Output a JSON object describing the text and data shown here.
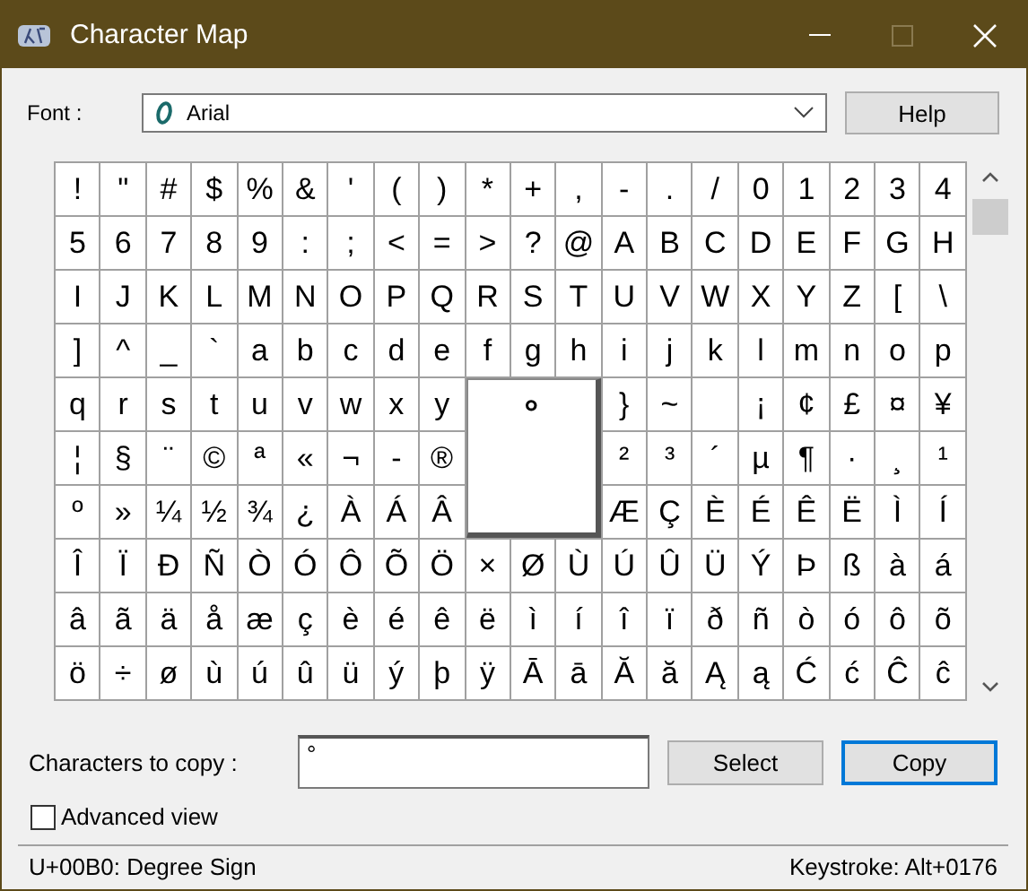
{
  "window": {
    "title": "Character Map",
    "maximize_disabled": true
  },
  "font": {
    "label": "Font :",
    "value": "Arial"
  },
  "help_button": "Help",
  "grid": [
    [
      "!",
      "\"",
      "#",
      "$",
      "%",
      "&",
      "'",
      "(",
      ")",
      "*",
      "+",
      ",",
      "-",
      ".",
      "/",
      "0",
      "1",
      "2",
      "3",
      "4"
    ],
    [
      "5",
      "6",
      "7",
      "8",
      "9",
      ":",
      ";",
      "<",
      "=",
      ">",
      "?",
      "@",
      "A",
      "B",
      "C",
      "D",
      "E",
      "F",
      "G",
      "H"
    ],
    [
      "I",
      "J",
      "K",
      "L",
      "M",
      "N",
      "O",
      "P",
      "Q",
      "R",
      "S",
      "T",
      "U",
      "V",
      "W",
      "X",
      "Y",
      "Z",
      "[",
      "\\"
    ],
    [
      "]",
      "^",
      "_",
      "`",
      "a",
      "b",
      "c",
      "d",
      "e",
      "f",
      "g",
      "h",
      "i",
      "j",
      "k",
      "l",
      "m",
      "n",
      "o",
      "p"
    ],
    [
      "q",
      "r",
      "s",
      "t",
      "u",
      "v",
      "w",
      "x",
      "y",
      "}",
      "~",
      {
        "kind": "blank"
      },
      "¡",
      "¢",
      "£",
      "¤",
      "¥"
    ],
    [
      "¦",
      "§",
      "¨",
      "©",
      "ª",
      "«",
      "¬",
      "-",
      "®",
      "²",
      "³",
      "´",
      "µ",
      "¶",
      "·",
      "¸",
      "¹"
    ],
    [
      "º",
      "»",
      "¼",
      "½",
      "¾",
      "¿",
      "À",
      "Á",
      "Â",
      "Æ",
      "Ç",
      "È",
      "É",
      "Ê",
      "Ë",
      "Ì",
      "Í"
    ],
    [
      "Î",
      "Ï",
      "Ð",
      "Ñ",
      "Ò",
      "Ó",
      "Ô",
      "Õ",
      "Ö",
      "×",
      "Ø",
      "Ù",
      "Ú",
      "Û",
      "Ü",
      "Ý",
      "Þ",
      "ß",
      "à",
      "á"
    ],
    [
      "â",
      "ã",
      "ä",
      "å",
      "æ",
      "ç",
      "è",
      "é",
      "ê",
      "ë",
      "ì",
      "í",
      "î",
      "ï",
      "ð",
      "ñ",
      "ò",
      "ó",
      "ô",
      "õ"
    ],
    [
      "ö",
      "÷",
      "ø",
      "ù",
      "ú",
      "û",
      "ü",
      "ý",
      "þ",
      "ÿ",
      "Ā",
      "ā",
      "Ă",
      "ă",
      "Ą",
      "ą",
      "Ć",
      "ć",
      "Ĉ",
      "ĉ"
    ]
  ],
  "magnifier": {
    "char": "°"
  },
  "copy": {
    "label": "Characters to copy :",
    "value": "°"
  },
  "buttons": [
    {
      "label": "Select",
      "default": false
    },
    {
      "label": "Copy",
      "default": true
    }
  ],
  "advanced_view": {
    "label": "Advanced view",
    "checked": false
  },
  "status_bar": {
    "character": "U+00B0: Degree Sign",
    "keystroke": "Keystroke: Alt+0176"
  }
}
